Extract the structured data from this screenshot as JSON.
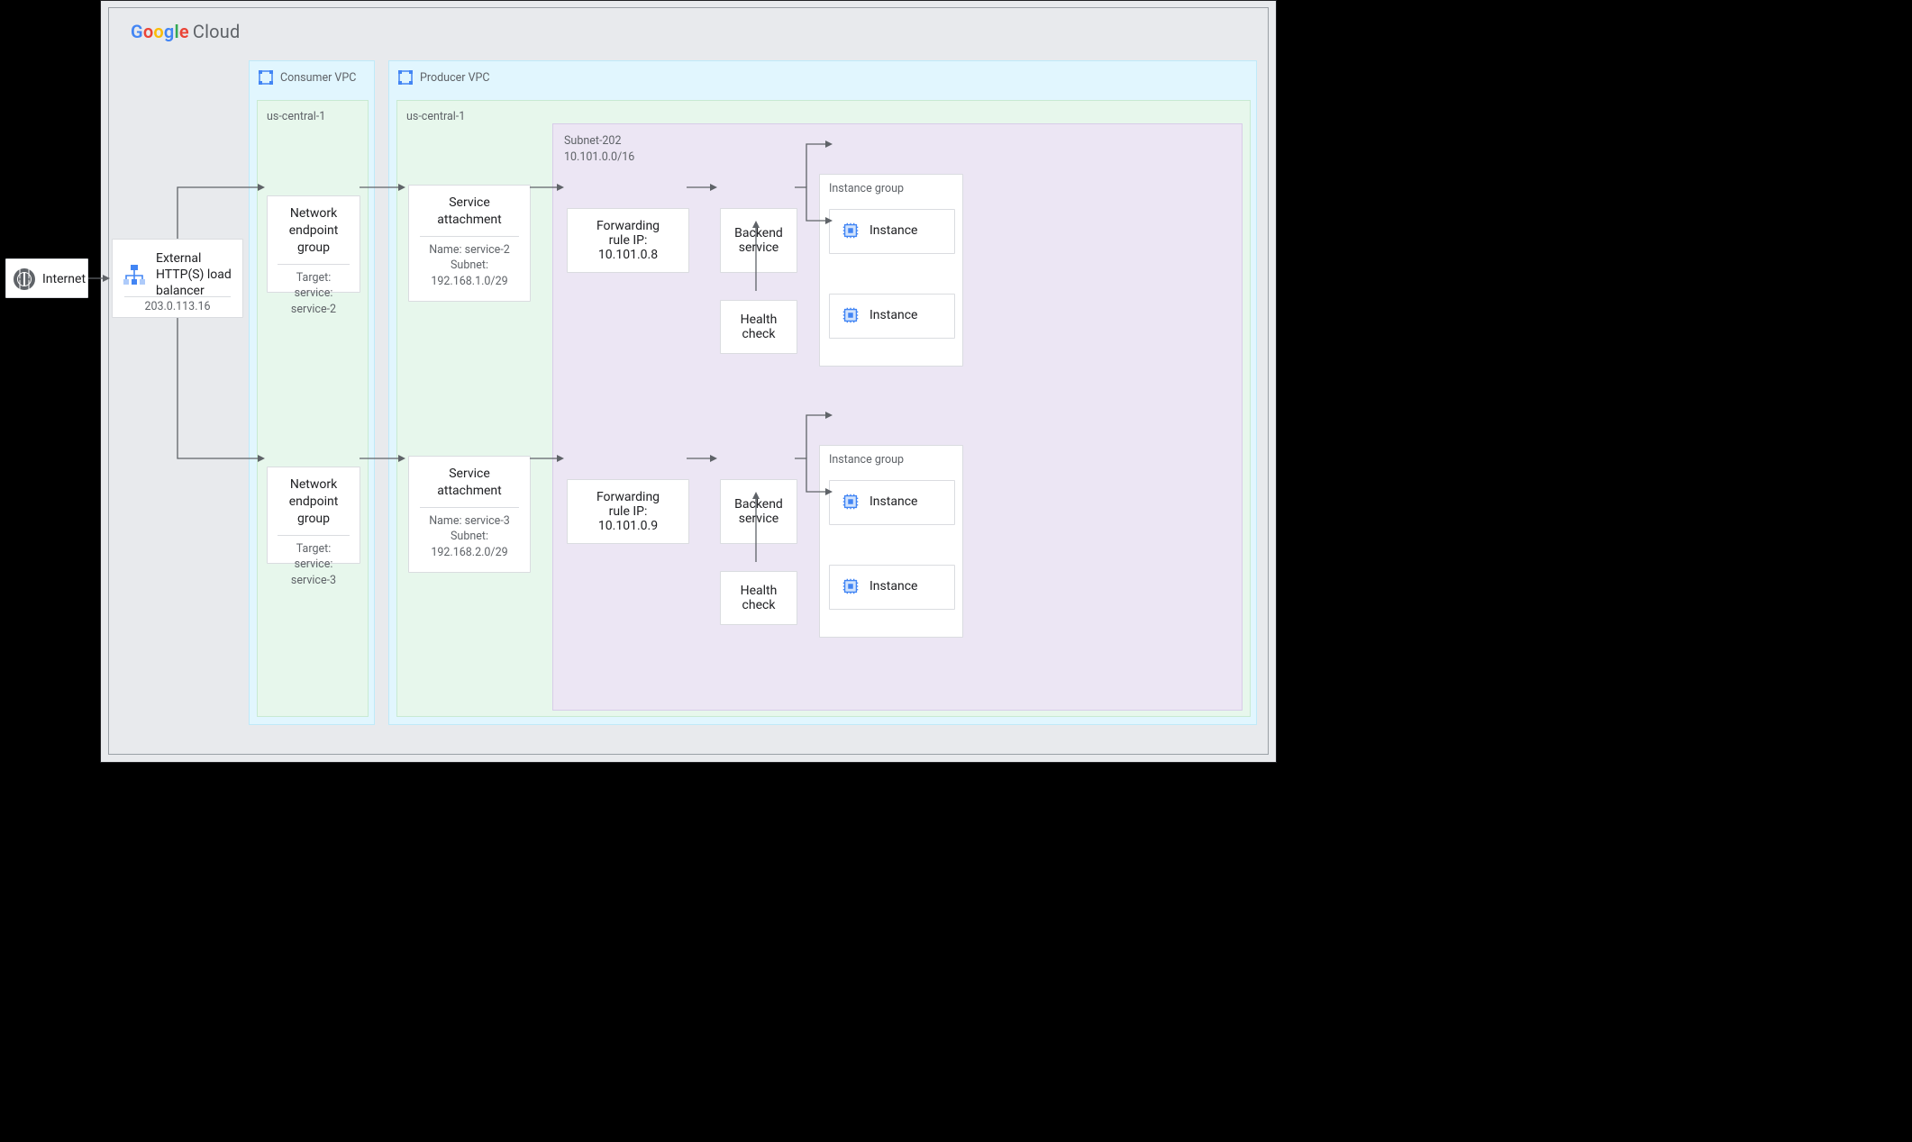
{
  "brand": {
    "cloud_word": "Cloud"
  },
  "internet": {
    "label": "Internet"
  },
  "lb": {
    "title": "External HTTP(S) load balancer",
    "ip": "203.0.113.16"
  },
  "consumer_vpc": {
    "title": "Consumer VPC",
    "region": "us-central-1",
    "neg1": {
      "title": "Network endpoint group",
      "target": "Target: service: service-2"
    },
    "neg2": {
      "title": "Network endpoint group",
      "target": "Target: service: service-3"
    }
  },
  "producer_vpc": {
    "title": "Producer VPC",
    "region": "us-central-1",
    "sa1": {
      "title": "Service attachment",
      "name": "Name: service-2",
      "subnet_lbl": "Subnet:",
      "subnet": "192.168.1.0/29"
    },
    "sa2": {
      "title": "Service attachment",
      "name": "Name: service-3",
      "subnet_lbl": "Subnet:",
      "subnet": "192.168.2.0/29"
    },
    "subnet": {
      "name": "Subnet-202",
      "cidr": "10.101.0.0/16"
    },
    "fr1": "Forwarding rule IP: 10.101.0.8",
    "fr2": "Forwarding rule IP: 10.101.0.9",
    "backend": "Backend service",
    "health": "Health check",
    "ig_title": "Instance group",
    "instance": "Instance"
  }
}
